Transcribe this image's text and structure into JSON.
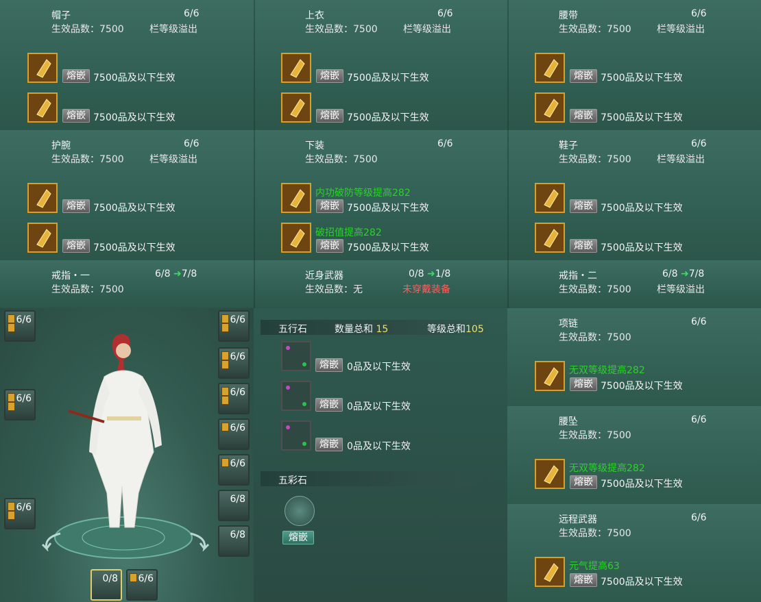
{
  "colors": {
    "accent_gold": "#d7a02b",
    "green_text": "#2cd12c",
    "warn_red": "#ff5e5e",
    "count_yellow": "#f0e06a"
  },
  "icons": {
    "gem": "gold-gem-icon",
    "empty_gem": "empty-gem-slot-icon",
    "wucai": "wucai-stone-icon"
  },
  "common": {
    "embed": "熔嵌",
    "effect": "7500品及以下生效",
    "overflow": "栏等级溢出",
    "quality": "生效品数：7500"
  },
  "panels": {
    "hat": {
      "title": "帽子",
      "count": "6/6"
    },
    "top": {
      "title": "上衣",
      "count": "6/6"
    },
    "belt": {
      "title": "腰带",
      "count": "6/6"
    },
    "wrist": {
      "title": "护腕",
      "count": "6/6"
    },
    "pants": {
      "title": "下装",
      "count": "6/6",
      "gem1_bonus": "内功破防等级提高282",
      "gem2_bonus": "破招值提高282"
    },
    "shoes": {
      "title": "鞋子",
      "count": "6/6"
    },
    "ring1": {
      "title": "戒指・一",
      "count": "6/8",
      "next": "7/8"
    },
    "melee": {
      "title": "近身武器",
      "count": "0/8",
      "next": "1/8",
      "quality": "生效品数：无",
      "status": "未穿戴装备"
    },
    "ring2": {
      "title": "戒指・二",
      "count": "6/8",
      "next": "7/8"
    },
    "necklace": {
      "title": "项链",
      "count": "6/6",
      "gem_bonus": "无双等级提高282"
    },
    "pendant": {
      "title": "腰坠",
      "count": "6/6",
      "gem_bonus": "无双等级提高282"
    },
    "ranged": {
      "title": "远程武器",
      "count": "6/6",
      "gem_bonus": "元气提高63"
    }
  },
  "wuxing": {
    "title": "五行石",
    "qty_label": "数量总和",
    "qty": "15",
    "lvl_label": "等级总和",
    "lvl": "105",
    "effect": "0品及以下生效"
  },
  "wucai": {
    "title": "五彩石",
    "button": "熔嵌"
  },
  "character": {
    "left_tags": [
      "6/6",
      "6/6",
      "6/6"
    ],
    "right_tags": [
      "6/6",
      "6/6",
      "6/6",
      "6/6",
      "6/6",
      "6/8",
      "6/8"
    ],
    "bottom_tags": [
      "0/8",
      "6/6"
    ]
  }
}
